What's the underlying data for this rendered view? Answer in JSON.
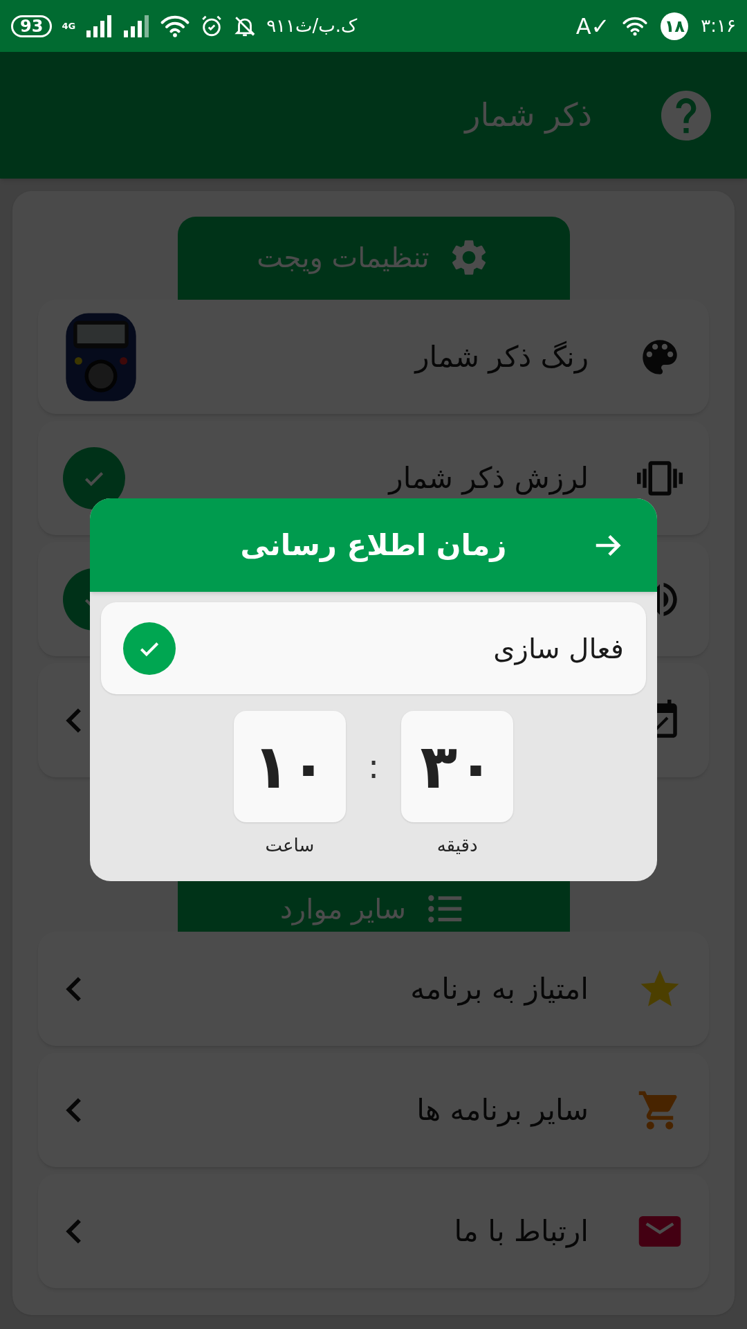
{
  "status_bar": {
    "battery": "93",
    "network": "4G",
    "carrier": "۹۱۱ک.ب/ث",
    "indicator": "A✓",
    "notification_count": "۱۸",
    "time": "۳:۱۶"
  },
  "app_bar": {
    "title": "ذکر شمار"
  },
  "sections": [
    {
      "title": "تنظیمات ویجت",
      "items": [
        {
          "kind": "image",
          "label": "رنگ ذکر شمار"
        },
        {
          "kind": "toggle",
          "label": "لرزش ذکر شمار",
          "checked": true
        },
        {
          "kind": "toggle",
          "checked": true
        },
        {
          "kind": "link"
        }
      ]
    },
    {
      "title": "سایر موارد",
      "items": [
        {
          "kind": "link",
          "label": "امتیاز به برنامه"
        },
        {
          "kind": "link",
          "label": "سایر برنامه ها"
        },
        {
          "kind": "link",
          "label": "ارتباط با ما"
        }
      ]
    }
  ],
  "dialog": {
    "title": "زمان اطلاع رسانی",
    "activation": {
      "label": "فعال سازی",
      "checked": true
    },
    "time": {
      "minute": "۳۰",
      "minute_label": "دقیقه",
      "separator": ":",
      "hour": "۱۰",
      "hour_label": "ساعت"
    }
  }
}
